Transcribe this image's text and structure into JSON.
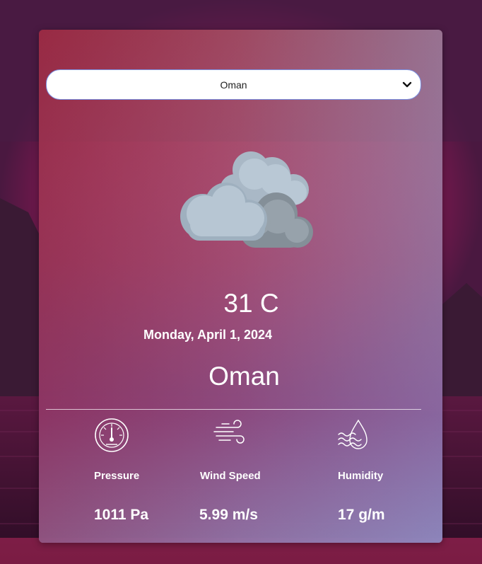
{
  "location_select": {
    "selected": "Oman"
  },
  "weather": {
    "condition_icon": "cloudy-icon",
    "temperature": "31 C",
    "date": "Monday, April 1, 2024",
    "city": "Oman"
  },
  "stats": [
    {
      "icon": "gauge-icon",
      "label": "Pressure",
      "value": "1011 Pa"
    },
    {
      "icon": "wind-icon",
      "label": "Wind Speed",
      "value": "5.99 m/s"
    },
    {
      "icon": "humidity-icon",
      "label": "Humidity",
      "value": "17 g/m"
    }
  ],
  "colors": {
    "card_top": "#a83a48",
    "card_bottom": "#8a7ab8",
    "select_border": "#7a8fe0",
    "text": "#ffffff"
  }
}
